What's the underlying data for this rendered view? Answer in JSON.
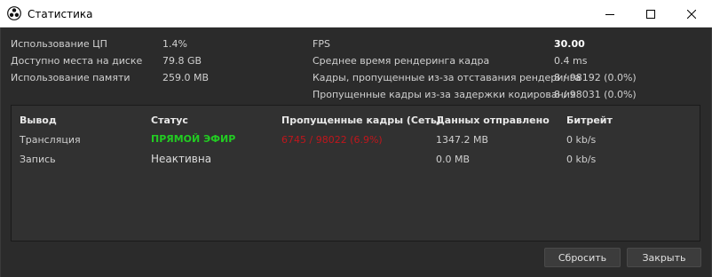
{
  "window": {
    "title": "Статистика",
    "controls": [
      "minimize-icon",
      "maximize-icon",
      "close-icon"
    ]
  },
  "stats_left": [
    {
      "label": "Использование ЦП",
      "value": "1.4%"
    },
    {
      "label": "Доступно места на диске",
      "value": "79.8 GB"
    },
    {
      "label": "Использование памяти",
      "value": "259.0 MB"
    }
  ],
  "stats_right": [
    {
      "label": "FPS",
      "value": "30.00"
    },
    {
      "label": "Среднее время рендеринга кадра",
      "value": "0.4 ms"
    },
    {
      "label": "Кадры, пропущенные из-за отставания рендеринга",
      "value": "8 / 98192 (0.0%)"
    },
    {
      "label": "Пропущенные кадры из-за задержки кодирования",
      "value": "8 / 98031 (0.0%)"
    }
  ],
  "outputs": {
    "headers": [
      "Вывод",
      "Статус",
      "Пропущенные кадры (Сеть)",
      "Данных отправлено",
      "Битрейт"
    ],
    "rows": [
      {
        "output": "Трансляция",
        "status": "ПРЯМОЙ ЭФИР",
        "dropped": "6745 / 98022 (6.9%)",
        "sent": "1347.2 MB",
        "bitrate": "0 kb/s"
      },
      {
        "output": "Запись",
        "status": "Неактивна",
        "dropped": "",
        "sent": "0.0 MB",
        "bitrate": "0 kb/s"
      }
    ]
  },
  "buttons": {
    "reset": "Сбросить",
    "close": "Закрыть"
  },
  "colors": {
    "background": "#2b2b2b",
    "live_status": "#22cc22",
    "dropped_frames": "#c0161c"
  }
}
